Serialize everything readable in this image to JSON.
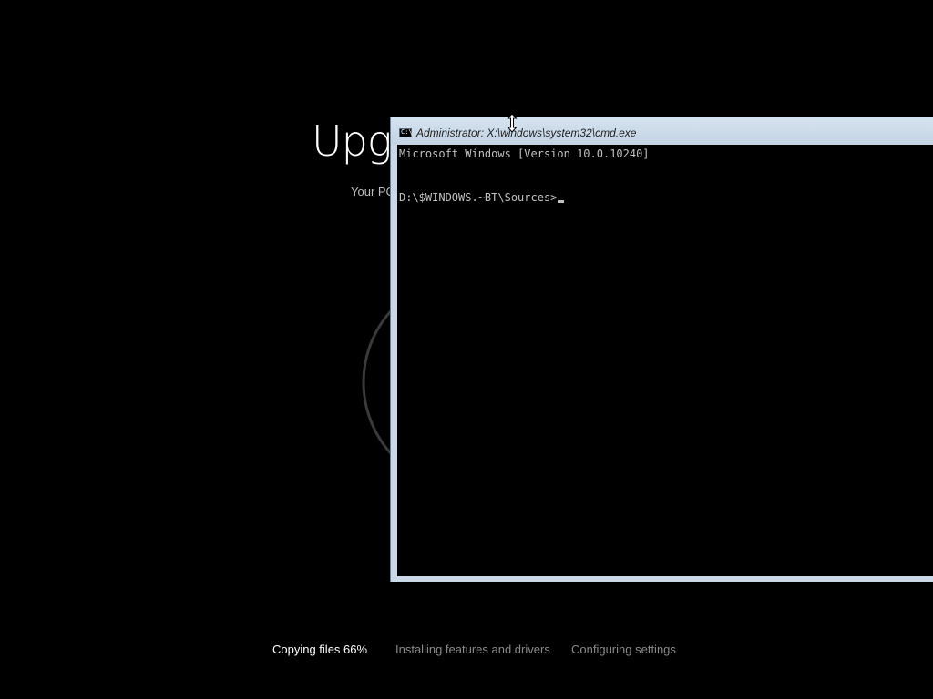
{
  "background": {
    "title": "Upgr",
    "subtitle": "Your PC v",
    "steps": [
      {
        "label": "Copying files 66%",
        "state": "active"
      },
      {
        "label": "Installing features and drivers",
        "state": "inactive"
      },
      {
        "label": "Configuring settings",
        "state": "inactive"
      }
    ]
  },
  "cmd": {
    "icon": "cmd-icon",
    "title": "Administrator: X:\\windows\\system32\\cmd.exe",
    "lines": [
      "Microsoft Windows [Version 10.0.10240]",
      "D:\\$WINDOWS.~BT\\Sources>"
    ]
  },
  "pointer": "vertical-resize-cursor-icon",
  "colors": {
    "background": "#000000",
    "console_text": "#c0c0c0",
    "window_frame": "#c9d7e6"
  }
}
